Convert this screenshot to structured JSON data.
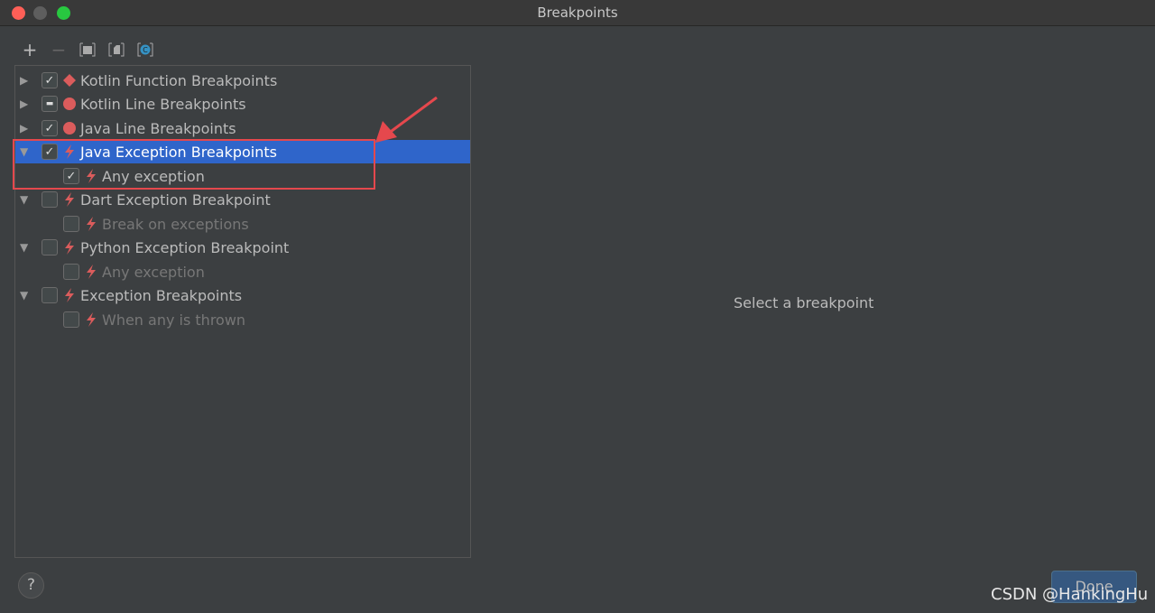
{
  "window": {
    "title": "Breakpoints"
  },
  "toolbar": {
    "items": [
      "add-icon",
      "remove-icon",
      "group-by-package-icon",
      "group-by-file-icon",
      "group-by-class-icon"
    ]
  },
  "tree": [
    {
      "label": "Kotlin Function Breakpoints",
      "expanded": false,
      "check": "checked",
      "icon": "kotlin-function-breakpoint-icon",
      "level": 0,
      "enabled": true
    },
    {
      "label": "Kotlin Line Breakpoints",
      "expanded": false,
      "check": "partial",
      "icon": "line-breakpoint-icon",
      "level": 0,
      "enabled": true
    },
    {
      "label": "Java Line Breakpoints",
      "expanded": false,
      "check": "checked",
      "icon": "line-breakpoint-icon",
      "level": 0,
      "enabled": true
    },
    {
      "label": "Java Exception Breakpoints",
      "expanded": true,
      "check": "checked",
      "icon": "exception-breakpoint-icon",
      "level": 0,
      "enabled": true,
      "selected": true
    },
    {
      "label": "Any exception",
      "check": "checked",
      "icon": "exception-breakpoint-icon",
      "level": 1,
      "enabled": true
    },
    {
      "label": "Dart Exception Breakpoint",
      "expanded": true,
      "check": "unchecked",
      "icon": "exception-breakpoint-icon",
      "level": 0,
      "enabled": true
    },
    {
      "label": "Break on exceptions",
      "check": "unchecked",
      "icon": "exception-breakpoint-icon",
      "level": 1,
      "enabled": false
    },
    {
      "label": "Python Exception Breakpoint",
      "expanded": true,
      "check": "unchecked",
      "icon": "exception-breakpoint-icon",
      "level": 0,
      "enabled": true
    },
    {
      "label": "Any exception",
      "check": "unchecked",
      "icon": "exception-breakpoint-icon",
      "level": 1,
      "enabled": false
    },
    {
      "label": "Exception Breakpoints",
      "expanded": true,
      "check": "unchecked",
      "icon": "exception-breakpoint-icon",
      "level": 0,
      "enabled": true
    },
    {
      "label": "When any is thrown",
      "check": "unchecked",
      "icon": "exception-breakpoint-icon",
      "level": 1,
      "enabled": false
    }
  ],
  "detail": {
    "placeholder": "Select a breakpoint"
  },
  "footer": {
    "help": "?",
    "done": "Done"
  },
  "watermark": "CSDN @HankingHu",
  "colors": {
    "selection": "#2f65ca",
    "breakpoint_red": "#db5c5c",
    "annotation": "#e5484d"
  }
}
